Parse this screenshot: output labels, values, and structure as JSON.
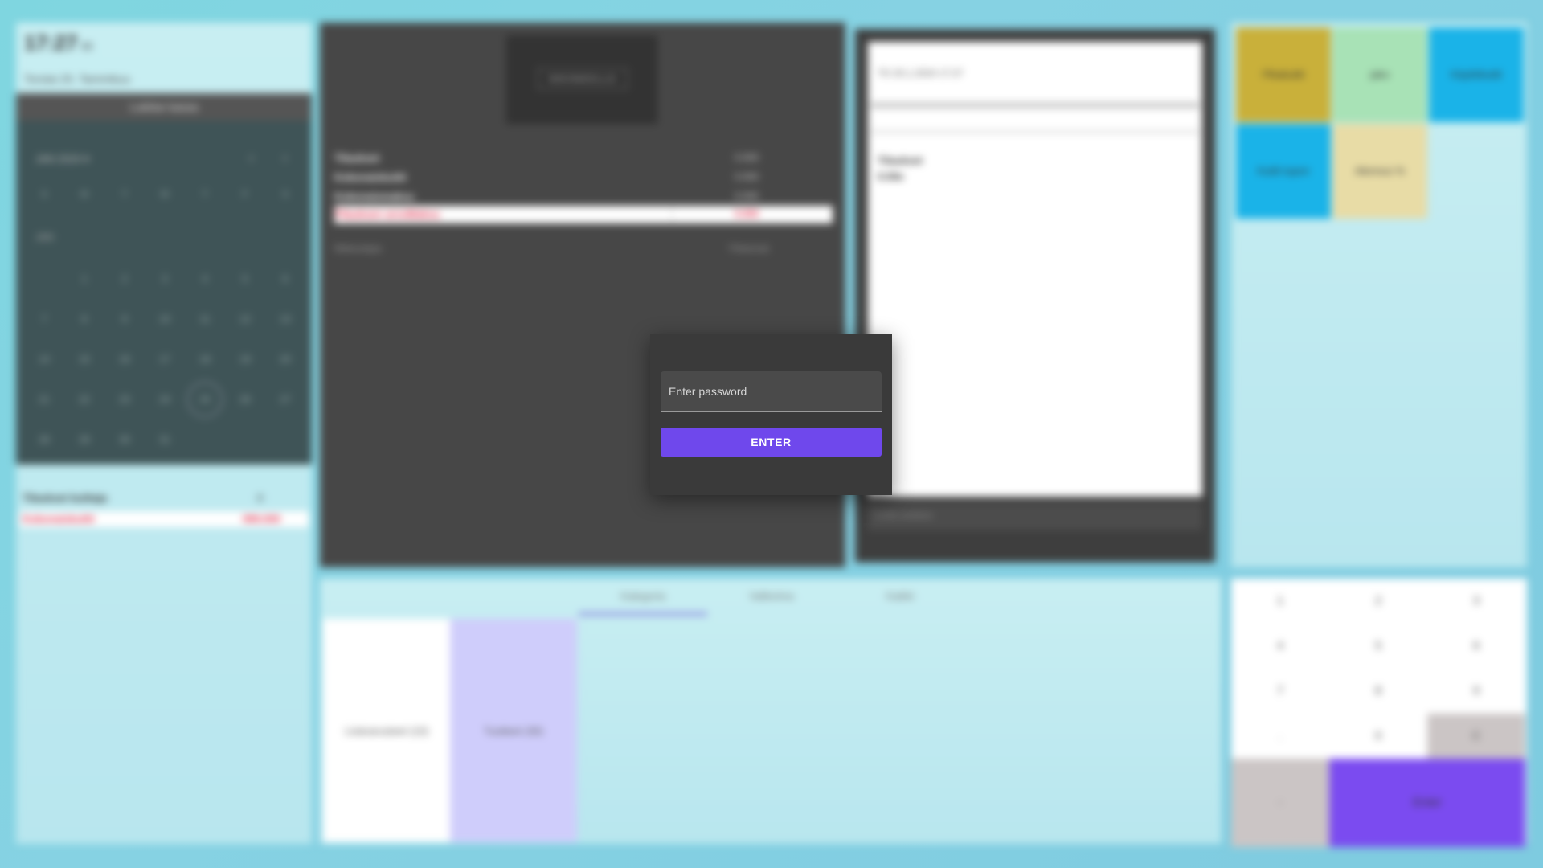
{
  "left": {
    "clock": "17:27",
    "clock_suffix": "03",
    "date_line": "Torstai 25. Tammikuu",
    "open_button": "Lukitse kassa",
    "calendar": {
      "month_label": "JAN 2024",
      "row_label": "JAN",
      "weekdays": [
        "S",
        "M",
        "T",
        "W",
        "T",
        "F",
        "S"
      ],
      "days": [
        "",
        "1",
        "2",
        "3",
        "4",
        "5",
        "6",
        "7",
        "8",
        "9",
        "10",
        "11",
        "12",
        "13",
        "14",
        "15",
        "16",
        "17",
        "18",
        "19",
        "20",
        "21",
        "22",
        "23",
        "24",
        "25",
        "26",
        "27",
        "28",
        "29",
        "30",
        "31"
      ],
      "today": "25"
    },
    "summary": {
      "title": "Tilaukset kuittaja",
      "count": "0",
      "row_label": "Kokonaiskuitti",
      "row_value": "999.000"
    }
  },
  "center": {
    "logo_text": "NIKINNOLLS",
    "stats": [
      {
        "label": "Tilaukset",
        "value": "0.000"
      },
      {
        "label": "Kokonaiskuitti",
        "value": "0.000"
      },
      {
        "label": "Kokonaismaksu",
        "value": "0.000"
      },
      {
        "label": "Tilauksen arvoMaksu",
        "value": "0.000"
      }
    ],
    "meta_left": "Maksutapa",
    "meta_right": "Yhteensä"
  },
  "receipt": {
    "date": "TO 25.1.2024 17:27",
    "title": "Tilaukset",
    "total": "0.00e",
    "input_placeholder": "Lisää asiakas"
  },
  "quick_buttons": [
    {
      "label": "Pikakuitti",
      "color": "#c9b03a"
    },
    {
      "label": "jako",
      "color": "#a8e2b6"
    },
    {
      "label": "Käyttökuitti",
      "color": "#1ab3e8"
    },
    {
      "label": "Kuitti tupon",
      "color": "#1ab3e8"
    },
    {
      "label": "Alennus %",
      "color": "#e8dca6"
    }
  ],
  "products": {
    "tabs": [
      "Kategoria",
      "Valikoima",
      "Kaikki"
    ],
    "tiles": [
      {
        "label": "Lisävarusteet (10)",
        "color": "#ffffff"
      },
      {
        "label": "Tuotteet (30)",
        "color": "#cfcdfb"
      }
    ]
  },
  "keypad": {
    "keys": [
      "1",
      "2",
      "3",
      "4",
      "5",
      "6",
      "7",
      "8",
      "9",
      ".",
      "0",
      "C"
    ],
    "minus": "-",
    "enter": "Enter"
  },
  "dialog": {
    "password_placeholder": "Enter password",
    "enter_label": "ENTER"
  }
}
